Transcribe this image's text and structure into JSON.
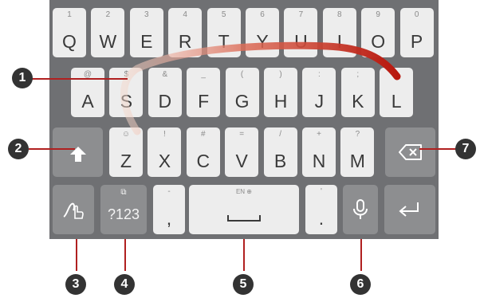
{
  "keyboard": {
    "row1": [
      {
        "hint": "1",
        "label": "Q"
      },
      {
        "hint": "2",
        "label": "W"
      },
      {
        "hint": "3",
        "label": "E"
      },
      {
        "hint": "4",
        "label": "R"
      },
      {
        "hint": "5",
        "label": "T"
      },
      {
        "hint": "6",
        "label": "Y"
      },
      {
        "hint": "7",
        "label": "U"
      },
      {
        "hint": "8",
        "label": "I"
      },
      {
        "hint": "9",
        "label": "O"
      },
      {
        "hint": "0",
        "label": "P"
      }
    ],
    "row2": [
      {
        "hint": "@",
        "label": "A"
      },
      {
        "hint": "$",
        "label": "S"
      },
      {
        "hint": "&",
        "label": "D"
      },
      {
        "hint": "_",
        "label": "F"
      },
      {
        "hint": "(",
        "label": "G"
      },
      {
        "hint": ")",
        "label": "H"
      },
      {
        "hint": ":",
        "label": "J"
      },
      {
        "hint": ";",
        "label": "K"
      },
      {
        "hint": "",
        "label": "L"
      }
    ],
    "row3": [
      {
        "hint": "☺",
        "label": "Z"
      },
      {
        "hint": "!",
        "label": "X"
      },
      {
        "hint": "#",
        "label": "C"
      },
      {
        "hint": "=",
        "label": "V"
      },
      {
        "hint": "/",
        "label": "B"
      },
      {
        "hint": "+",
        "label": "N"
      },
      {
        "hint": "?",
        "label": "M"
      }
    ],
    "row4": {
      "symbols_label": "?123",
      "comma_hint": "-",
      "comma_label": ",",
      "space_hint": "EN ⊕",
      "period_hint": "'",
      "period_label": "."
    }
  },
  "callouts": [
    "1",
    "2",
    "3",
    "4",
    "5",
    "6",
    "7"
  ],
  "icons": {
    "shift": "shift-icon",
    "backspace": "backspace-icon",
    "gesture": "swipe-gesture-icon",
    "mic": "microphone-icon",
    "enter": "enter-icon"
  },
  "colors": {
    "keyboard_bg": "#6f7073",
    "letter_key": "#ededed",
    "function_key": "#8d8e90",
    "swipe_trail": "#c0281c",
    "callout_line": "#b02020"
  }
}
